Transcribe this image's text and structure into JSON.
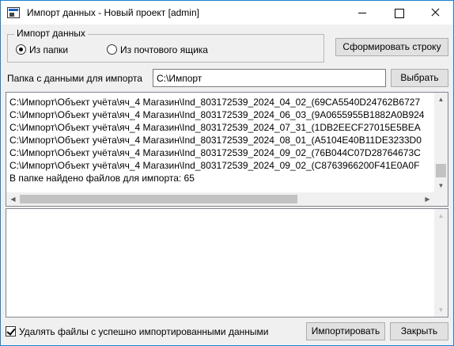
{
  "window": {
    "title": "Импорт данных - Новый проект [admin]"
  },
  "import_group": {
    "title": "Импорт данных",
    "options": [
      {
        "label": "Из папки",
        "checked": true
      },
      {
        "label": "Из почтового ящика",
        "checked": false
      }
    ]
  },
  "toolbar": {
    "form_string_label": "Сформировать строку",
    "browse_label": "Выбрать"
  },
  "folder": {
    "label": "Папка с данными для импорта",
    "value": "C:\\Импорт"
  },
  "log": {
    "lines": [
      "C:\\Импорт\\Объект учёта\\яч_4 Магазин\\Ind_803172539_2024_04_02_(69CA5540D24762B6727",
      "C:\\Импорт\\Объект учёта\\яч_4 Магазин\\Ind_803172539_2024_06_03_(9A0655955B1882A0B924",
      "C:\\Импорт\\Объект учёта\\яч_4 Магазин\\Ind_803172539_2024_07_31_(1DB2EECF27015E5BEA",
      "C:\\Импорт\\Объект учёта\\яч_4 Магазин\\Ind_803172539_2024_08_01_(A5104E40B11DE3233D0",
      "C:\\Импорт\\Объект учёта\\яч_4 Магазин\\Ind_803172539_2024_09_02_(76B044C07D28764673C",
      "C:\\Импорт\\Объект учёта\\яч_4 Магазин\\Ind_803172539_2024_09_02_(C8763966200F41E0A0F",
      "В папке найдено файлов для импорта: 65"
    ]
  },
  "footer": {
    "delete_files_label": "Удалять файлы с успешно импортированными данными",
    "delete_files_checked": true,
    "import_label": "Импортировать",
    "close_label": "Закрыть"
  }
}
